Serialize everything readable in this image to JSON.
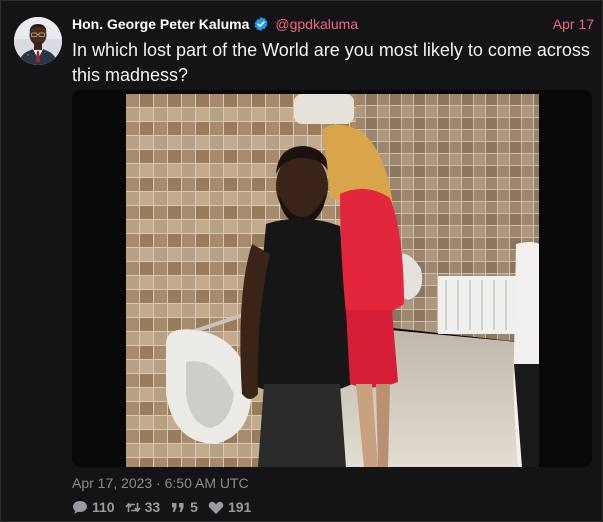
{
  "author": {
    "display_name": "Hon. George Peter Kaluma",
    "handle": "@gpdkaluma",
    "verified": true
  },
  "header_date": "Apr 17",
  "tweet": {
    "text": "In which lost part of the World are you most likely to come across this madness?"
  },
  "timestamp": "Apr 17, 2023 · 6:50 AM UTC",
  "stats": {
    "replies": "110",
    "retweets": "33",
    "quotes": "5",
    "likes": "191"
  },
  "icons": {
    "verified": "verified-badge-icon",
    "reply": "speech-bubble-icon",
    "retweet": "retweet-icon",
    "quote": "quote-icon",
    "like": "heart-icon"
  },
  "colors": {
    "background": "#141416",
    "accent": "#f0677a",
    "verified": "#1d9bf0",
    "muted": "#8b8b93"
  }
}
